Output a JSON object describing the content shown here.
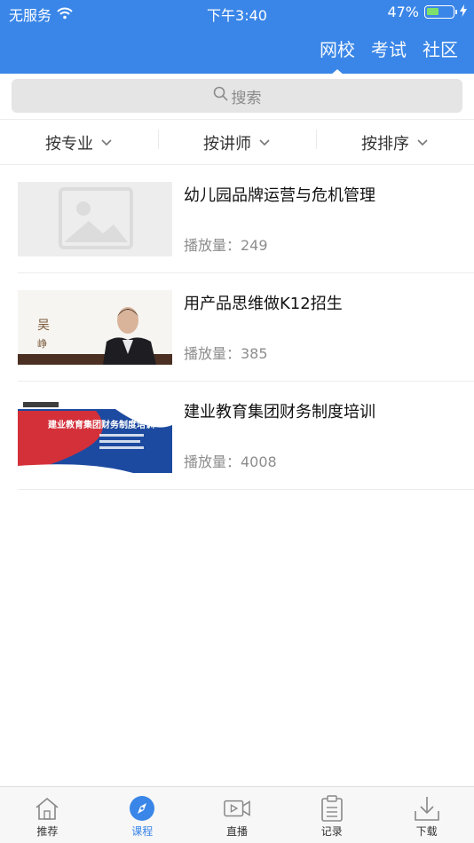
{
  "status_bar": {
    "carrier": "无服务",
    "time": "下午3:40",
    "battery": "47%",
    "battery_level": 0.47
  },
  "header": {
    "tabs": [
      {
        "label": "网校",
        "active": true
      },
      {
        "label": "考试",
        "active": false
      },
      {
        "label": "社区",
        "active": false
      }
    ]
  },
  "search": {
    "placeholder": "搜索",
    "icon": "search-icon"
  },
  "filters": [
    {
      "label": "按专业",
      "icon": "chevron-down-icon"
    },
    {
      "label": "按讲师",
      "icon": "chevron-down-icon"
    },
    {
      "label": "按排序",
      "icon": "chevron-down-icon"
    }
  ],
  "courses": [
    {
      "title": "幼儿园品牌运营与危机管理",
      "plays_label": "播放量：249",
      "thumb": "placeholder-image"
    },
    {
      "title": "用产品思维做K12招生",
      "plays_label": "播放量：385",
      "thumb": "lecturer-photo"
    },
    {
      "title": "建业教育集团财务制度培训",
      "plays_label": "播放量：4008",
      "thumb": "training-slide"
    }
  ],
  "thumb_text": {
    "course2_name": "吴",
    "course2_name2": "峥",
    "course3_slide_title": "建业教育集团财务制度培训"
  },
  "bottom_nav": [
    {
      "label": "推荐",
      "icon": "home-icon",
      "active": false
    },
    {
      "label": "课程",
      "icon": "compass-icon",
      "active": true
    },
    {
      "label": "直播",
      "icon": "video-camera-icon",
      "active": false
    },
    {
      "label": "记录",
      "icon": "clipboard-icon",
      "active": false
    },
    {
      "label": "下载",
      "icon": "download-icon",
      "active": false
    }
  ],
  "colors": {
    "accent": "#3a86e8",
    "battery_fill": "#7ee06c"
  }
}
